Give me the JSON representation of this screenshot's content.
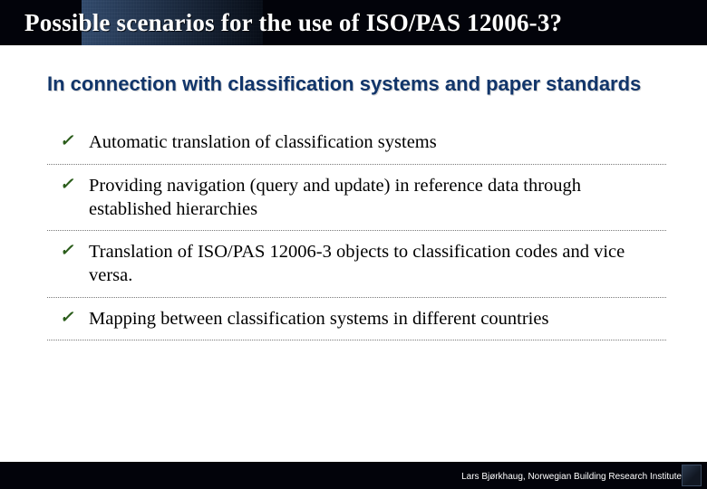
{
  "title": "Possible scenarios for the use of ISO/PAS 12006-3?",
  "subtitle": "In connection with classification systems and paper standards",
  "bullets": [
    "Automatic translation of classification systems",
    "Providing navigation (query and update) in reference data through established hierarchies",
    "Translation of ISO/PAS 12006-3 objects to classification codes and vice versa.",
    "Mapping between classification systems in different countries"
  ],
  "footer": "Lars Bjørkhaug, Norwegian Building Research Institute",
  "check_glyph": "✓"
}
